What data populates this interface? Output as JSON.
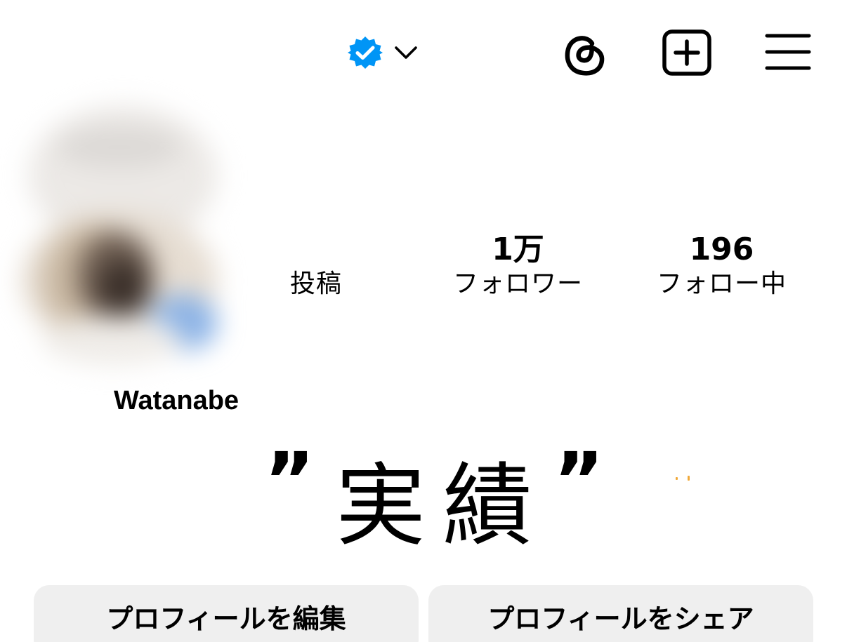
{
  "header": {
    "verified_color": "#0095f6",
    "icons": [
      "verified-badge-icon",
      "chevron-down-icon",
      "threads-icon",
      "create-post-icon",
      "menu-icon"
    ]
  },
  "profile": {
    "name": "Watanabe",
    "stats": {
      "posts": {
        "value": "",
        "label": "投稿"
      },
      "followers": {
        "value": "1万",
        "label": "フォロワー"
      },
      "following": {
        "value": "196",
        "label": "フォロー中"
      }
    }
  },
  "bio": {
    "open_quote": "”",
    "headline": "実績",
    "close_quote": "”"
  },
  "buttons": {
    "edit_label": "プロフィールを編集",
    "share_label": "プロフィールをシェア"
  }
}
